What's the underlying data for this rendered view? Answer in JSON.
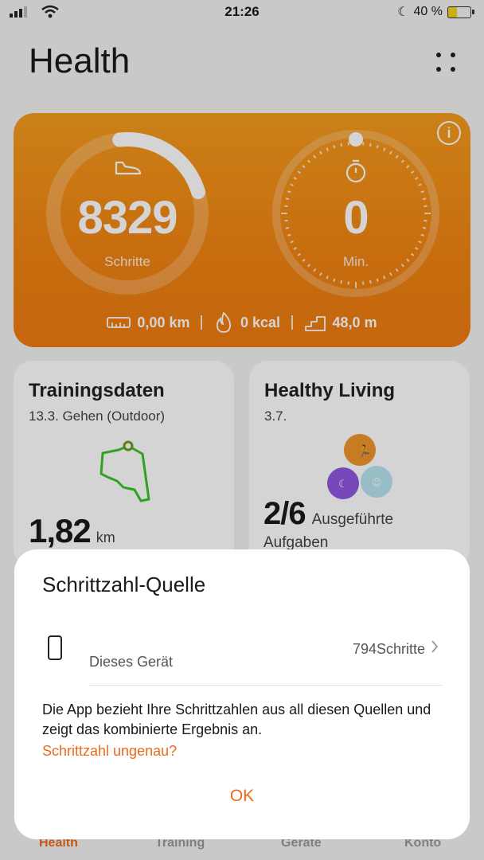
{
  "status_bar": {
    "time": "21:26",
    "battery": "40 %"
  },
  "header": {
    "title": "Health"
  },
  "activity_card": {
    "steps_value": "8329",
    "steps_label": "Schritte",
    "steps_progress": 0.22,
    "minutes_value": "0",
    "minutes_label": "Min.",
    "distance": "0,00 km",
    "calories": "0 kcal",
    "climb": "48,0 m"
  },
  "training_card": {
    "title": "Trainingsdaten",
    "subtitle": "13.3. Gehen (Outdoor)",
    "distance_value": "1,82",
    "distance_unit": "km"
  },
  "healthy_card": {
    "title": "Healthy Living",
    "subtitle": "3.7.",
    "tasks_value": "2/6",
    "tasks_label_1": "Ausgeführte",
    "tasks_label_2": "Aufgaben"
  },
  "tabbar": {
    "items": [
      "Health",
      "Training",
      "Geräte",
      "Konto"
    ]
  },
  "dialog": {
    "title": "Schrittzahl-Quelle",
    "device_label": "Dieses Gerät",
    "device_value": "794Schritte",
    "description": "Die App bezieht Ihre Schrittzahlen aus all diesen Quellen und zeigt das kombinierte Ergebnis an.",
    "link": "Schrittzahl ungenau?",
    "ok": "OK"
  },
  "colors": {
    "accent": "#ec6a1b",
    "card_orange": "#f08413"
  }
}
